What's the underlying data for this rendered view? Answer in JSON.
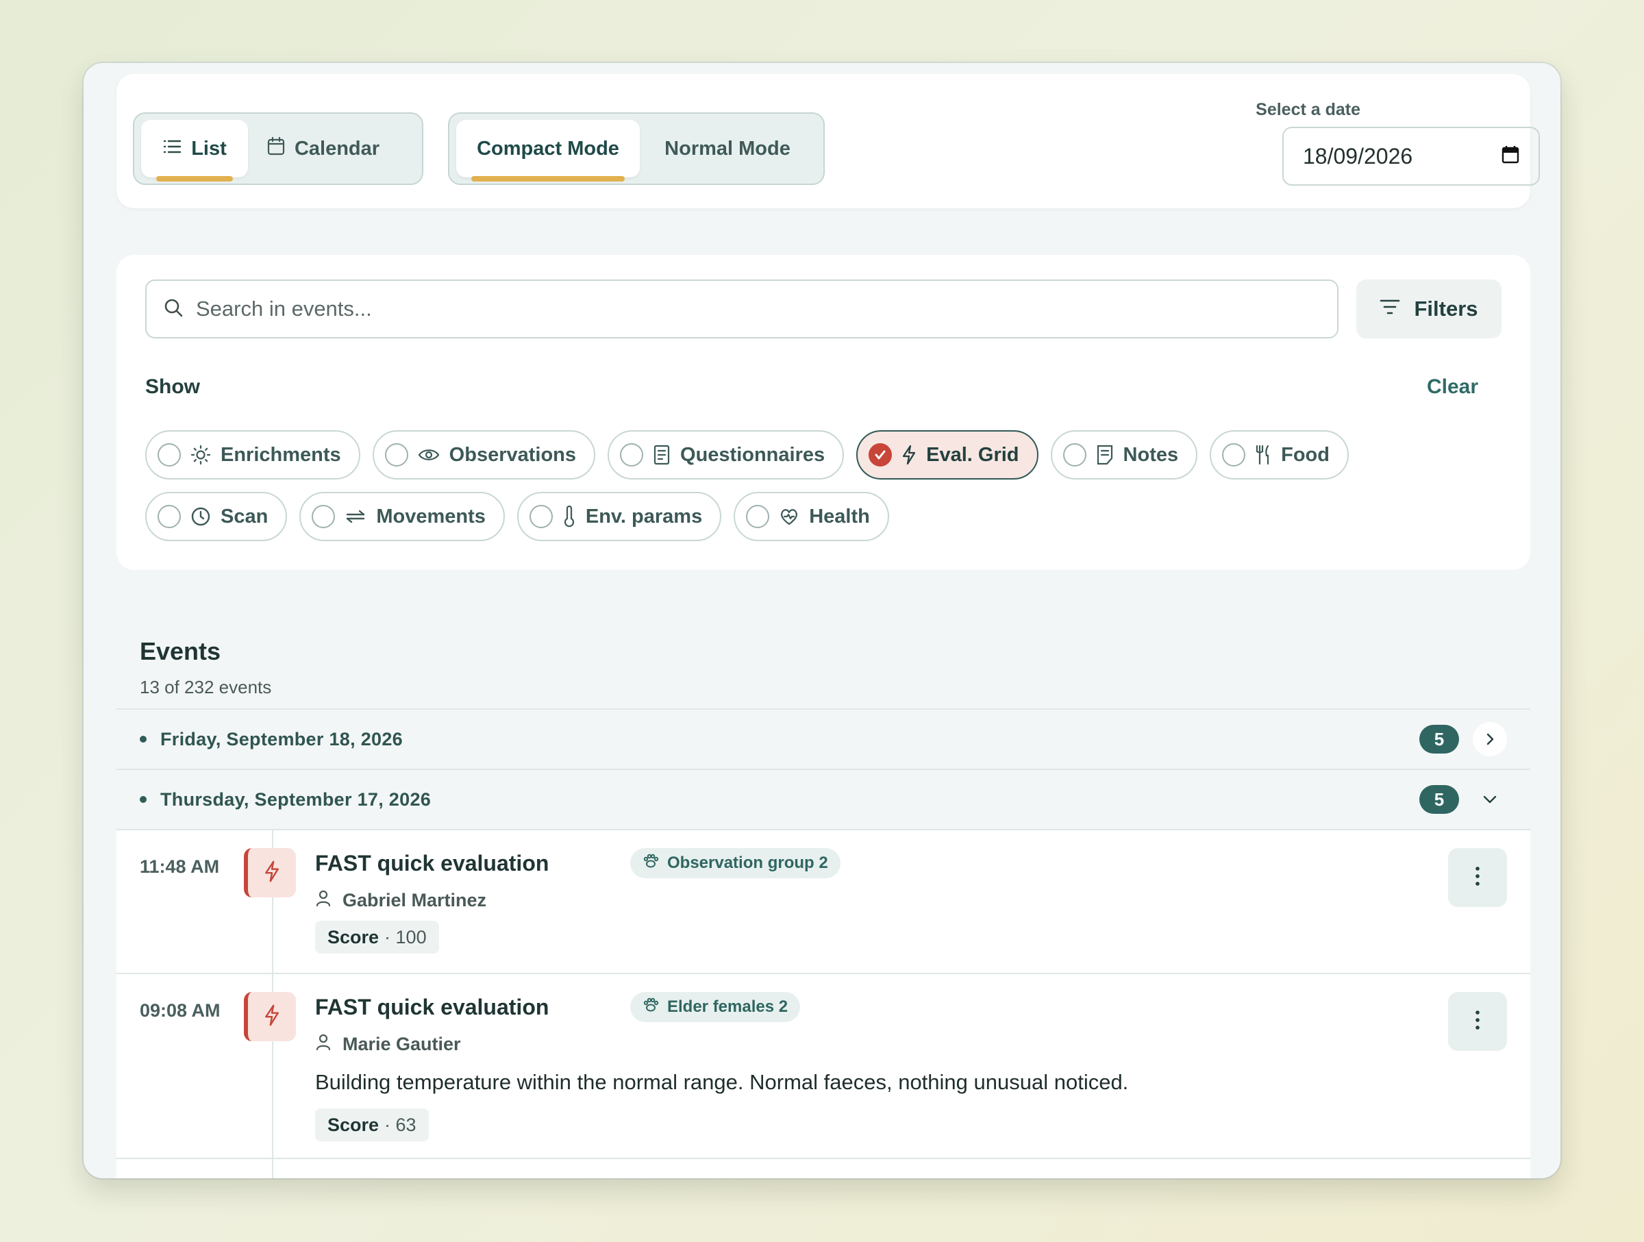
{
  "view_toggle": {
    "list": "List",
    "calendar": "Calendar"
  },
  "mode_toggle": {
    "compact": "Compact Mode",
    "normal": "Normal Mode"
  },
  "date_picker": {
    "label": "Select a date",
    "value": "18/09/2026"
  },
  "search": {
    "placeholder": "Search in events..."
  },
  "filters_button": "Filters",
  "show_label": "Show",
  "clear_button": "Clear",
  "chips": [
    {
      "label": "Enrichments",
      "icon": "sun-icon",
      "selected": false
    },
    {
      "label": "Observations",
      "icon": "eye-icon",
      "selected": false
    },
    {
      "label": "Questionnaires",
      "icon": "document-icon",
      "selected": false
    },
    {
      "label": "Eval. Grid",
      "icon": "lightning-icon",
      "selected": true
    },
    {
      "label": "Notes",
      "icon": "note-icon",
      "selected": false
    },
    {
      "label": "Food",
      "icon": "utensils-icon",
      "selected": false
    },
    {
      "label": "Scan",
      "icon": "clock-icon",
      "selected": false
    },
    {
      "label": "Movements",
      "icon": "arrows-icon",
      "selected": false
    },
    {
      "label": "Env. params",
      "icon": "thermometer-icon",
      "selected": false
    },
    {
      "label": "Health",
      "icon": "heart-icon",
      "selected": false
    }
  ],
  "events": {
    "title": "Events",
    "count": "13 of 232 events",
    "days": [
      {
        "label": "Friday, September 18, 2026",
        "count": "5",
        "expanded": false
      },
      {
        "label": "Thursday, September 17, 2026",
        "count": "5",
        "expanded": true
      }
    ],
    "items": [
      {
        "time": "11:48 AM",
        "title": "FAST quick evaluation",
        "group": "Observation group 2",
        "user": "Gabriel Martinez",
        "description": "",
        "score_label": "Score",
        "score_value": "· 100"
      },
      {
        "time": "09:08 AM",
        "title": "FAST quick evaluation",
        "group": "Elder females 2",
        "user": "Marie Gautier",
        "description": "Building temperature within the normal range. Normal faeces, nothing unusual noticed.",
        "score_label": "Score",
        "score_value": "· 63"
      }
    ]
  },
  "colors": {
    "accent_yellow": "#e2b14f",
    "teal": "#2f6662",
    "red": "#c8453a"
  }
}
